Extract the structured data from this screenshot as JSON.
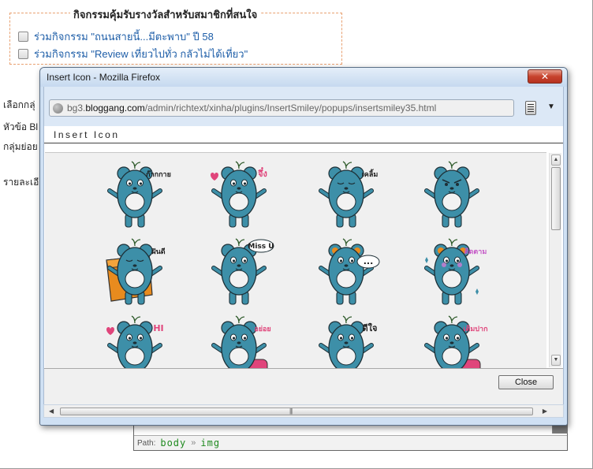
{
  "background_page": {
    "legend": "กิจกรรมคุ้มรับรางวัลสำหรับสมาชิกที่สนใจ",
    "activities": [
      {
        "label": "ร่วมกิจกรรม \"ถนนสายนี้...มีตะพาบ\" ปี 58",
        "checked": false
      },
      {
        "label": "ร่วมกิจกรรม \"Review เที่ยวไปทั่ว กลัวไม่ได้เที่ยว\"",
        "checked": false
      }
    ],
    "side_labels": [
      "เลือกกลุ่",
      "หัวข้อ Bl",
      "กลุ่มย่อย",
      "รายละเอี"
    ],
    "status_path": {
      "label": "Path:",
      "item1": "body",
      "separator": "»",
      "item2": "img"
    }
  },
  "popup": {
    "title": "Insert Icon - Mozilla Firefox",
    "close_symbol": "✕",
    "url_prefix": "bg3.",
    "url_domain": "bloggang.com",
    "url_path": "/admin/richtext/xinha/plugins/InsertSmiley/popups/insertsmiley35.html",
    "menu_arrow": "▼",
    "heading": "Insert Icon",
    "close_button": "Close",
    "scroll_up": "▲",
    "scroll_down": "▼",
    "scroll_left": "◀",
    "scroll_right": "▶",
    "scroll_grip": "|||"
  },
  "stickers": [
    {
      "caption": "ก๊ากกาย",
      "pose": "point",
      "accent": "#1d1d1d"
    },
    {
      "caption": "จึ๋ง",
      "pose": "heart",
      "accent": "#e0457b"
    },
    {
      "caption": "เคลิ้ม",
      "pose": "dream",
      "accent": "#1d1d1d"
    },
    {
      "caption": "",
      "pose": "angry",
      "accent": "#1d1d1d"
    },
    {
      "caption": "ฝันดี",
      "pose": "sleep",
      "accent": "#e88b1e"
    },
    {
      "caption": "Miss U",
      "pose": "miss",
      "accent": "#1d1d1d"
    },
    {
      "caption": "...",
      "pose": "dots",
      "accent": "#1d1d1d"
    },
    {
      "caption": "ติดตาม",
      "pose": "shy",
      "accent": "#c456c6"
    },
    {
      "caption": "HI",
      "pose": "hi",
      "accent": "#e0457b"
    },
    {
      "caption": "อย่อย",
      "pose": "eat",
      "accent": "#e0457b"
    },
    {
      "caption": "ดีใจ",
      "pose": "happy",
      "accent": "#1d1d1d"
    },
    {
      "caption": "เติมปาก",
      "pose": "bathe",
      "accent": "#e0457b"
    }
  ],
  "colors": {
    "sticker_body": "#3d8fa8",
    "sticker_belly": "#f2f2f2",
    "link": "#1e5ea8",
    "path_text": "#1f8a1f",
    "titlebar_close": "#c7432d"
  }
}
